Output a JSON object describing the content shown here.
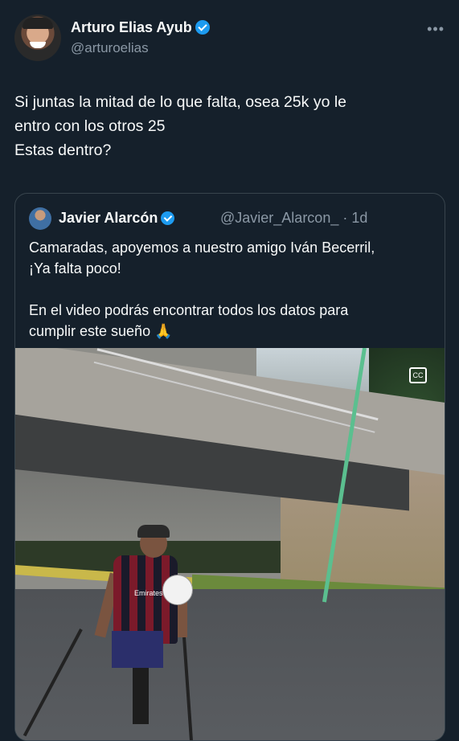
{
  "author": {
    "name": "Arturo Elias Ayub",
    "handle": "@arturoelias"
  },
  "more_icon": "•••",
  "tweet_lines": [
    "Si juntas la mitad de lo que falta, osea 25k yo le",
    "entro con los otros 25",
    "Estas dentro?"
  ],
  "quote": {
    "name": "Javier Alarcón",
    "meta": "@Javier_Alarcon_ · 1d",
    "lines": [
      "Camaradas, apoyemos a nuestro amigo Iván Becerril,",
      "¡Ya falta poco!",
      "",
      "En el video podrás encontrar todos los datos para",
      "cumplir este sueño 🙏"
    ],
    "jersey_text": "Emirates"
  },
  "colors": {
    "background": "#15202b",
    "verified": "#1d9bf0",
    "secondary_text": "#8b98a5",
    "border": "#38444d"
  },
  "icons": {
    "verified": "verified-badge-icon",
    "more": "more-options-icon",
    "media": "video-captions-icon"
  }
}
